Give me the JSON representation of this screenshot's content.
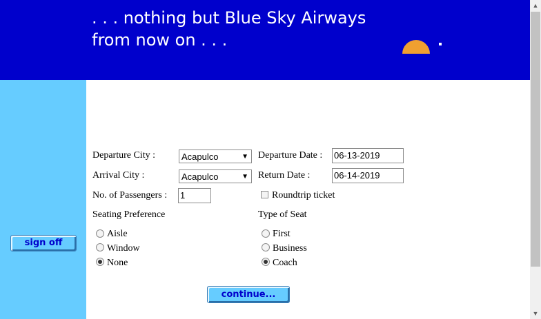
{
  "header": {
    "tagline_line1": ". . . nothing but Blue Sky Airways",
    "tagline_line2": "from now on . . ."
  },
  "sidebar": {
    "signoff_label": "sign off"
  },
  "form": {
    "departure_city_label": "Departure City :",
    "departure_city_value": "Acapulco",
    "departure_date_label": "Departure Date :",
    "departure_date_value": "06-13-2019",
    "arrival_city_label": "Arrival City :",
    "arrival_city_value": "Acapulco",
    "return_date_label": "Return Date :",
    "return_date_value": "06-14-2019",
    "passengers_label": "No. of Passengers :",
    "passengers_value": "1",
    "roundtrip_label": "Roundtrip ticket",
    "roundtrip_checked": false,
    "seating_pref_label": "Seating Preference",
    "seating_options": [
      "Aisle",
      "Window",
      "None"
    ],
    "seating_selected": "None",
    "seat_type_label": "Type of Seat",
    "seat_type_options": [
      "First",
      "Business",
      "Coach"
    ],
    "seat_type_selected": "Coach",
    "continue_label": "continue..."
  },
  "colors": {
    "banner": "#0000cc",
    "sidebar": "#66ccff",
    "button_text": "#0000cc"
  },
  "icons": {
    "dropdown": "triangle-down",
    "scroll_up": "scroll-up-arrow",
    "scroll_down": "scroll-down-arrow"
  }
}
